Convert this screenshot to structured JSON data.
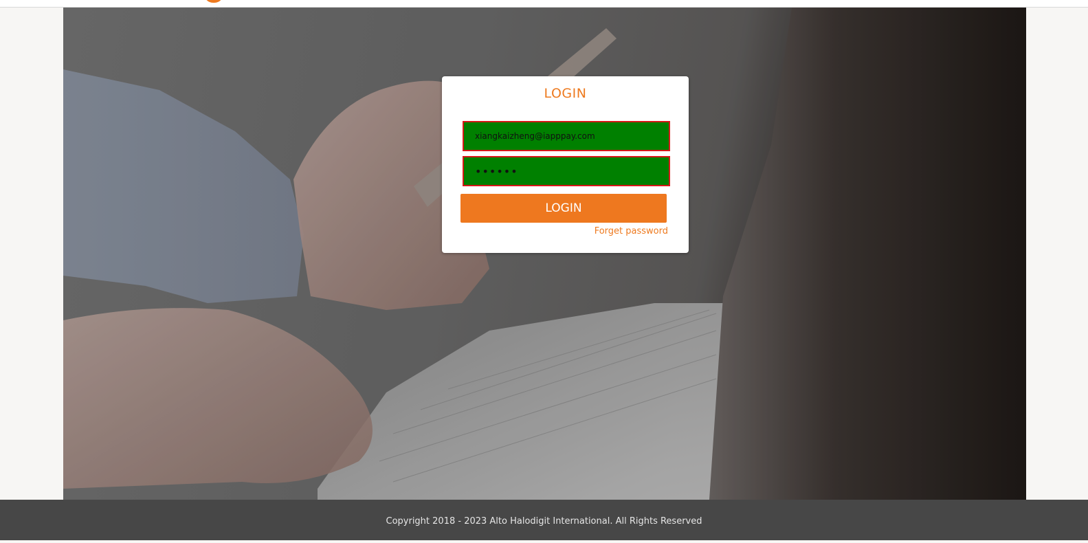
{
  "login": {
    "title": "LOGIN",
    "email_value": "xiangkaizheng@iapppay.com",
    "password_value": "••••••",
    "button_label": "LOGIN",
    "forget_password_label": "Forget password"
  },
  "footer": {
    "copyright": "Copyright 2018 - 2023 Alto Halodigit International. All Rights Reserved"
  },
  "colors": {
    "accent": "#ee7a1f",
    "field_background": "#008000",
    "field_border": "#d71818",
    "footer_background": "#474747"
  }
}
